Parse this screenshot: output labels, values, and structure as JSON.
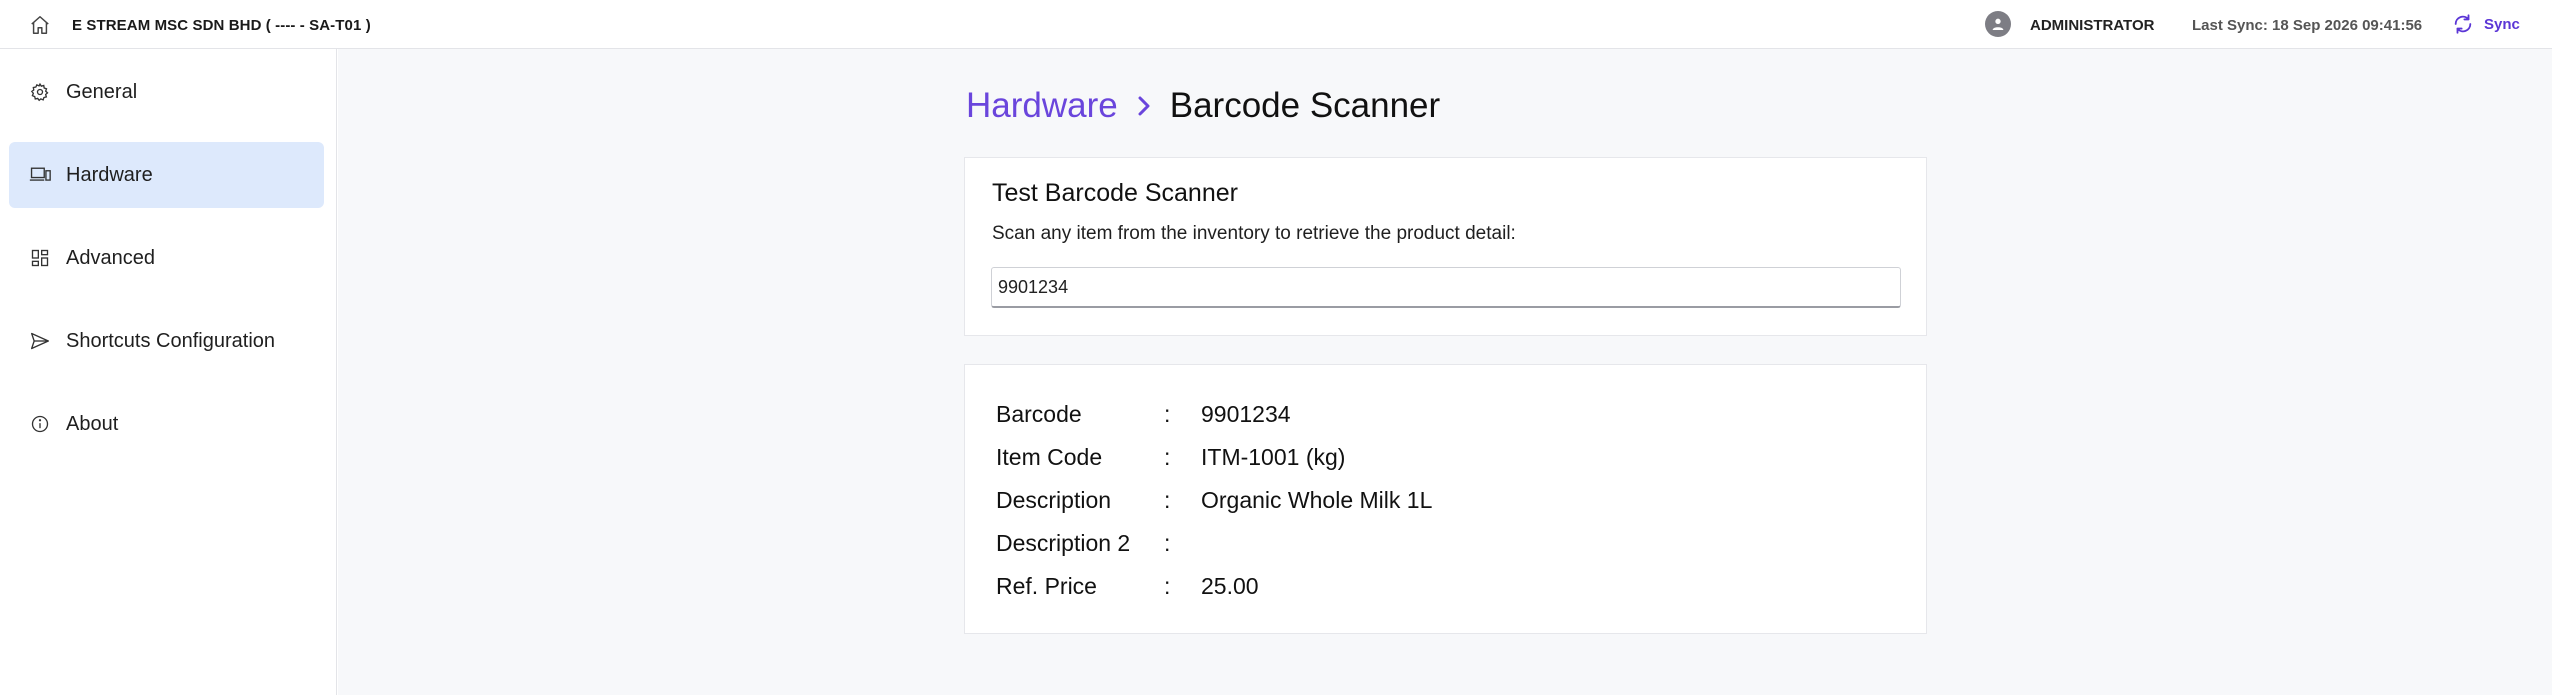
{
  "topbar": {
    "company": "E STREAM MSC SDN BHD ( ---- - SA-T01 )",
    "user": "ADMINISTRATOR",
    "last_sync": "Last Sync: 18 Sep 2026 09:41:56",
    "sync_label": "Sync",
    "icons": {
      "home": "home-icon",
      "avatar": "user-icon",
      "sync": "sync-icon"
    }
  },
  "sidebar": {
    "items": [
      {
        "label": "General",
        "icon": "gear-icon",
        "active": false
      },
      {
        "label": "Hardware",
        "icon": "devices-icon",
        "active": true
      },
      {
        "label": "Advanced",
        "icon": "grid-icon",
        "active": false
      },
      {
        "label": "Shortcuts Configuration",
        "icon": "send-icon",
        "active": false
      },
      {
        "label": "About",
        "icon": "info-icon",
        "active": false
      }
    ]
  },
  "breadcrumb": {
    "parent": "Hardware",
    "current": "Barcode Scanner"
  },
  "test_card": {
    "title": "Test Barcode Scanner",
    "subtitle": "Scan any item from the inventory to retrieve the product detail:",
    "input_value": "9901234"
  },
  "detail_card": {
    "rows": [
      {
        "label": "Barcode",
        "sep": ":",
        "value": "9901234"
      },
      {
        "label": "Item Code",
        "sep": ":",
        "value": "ITM-1001 (kg)"
      },
      {
        "label": "Description",
        "sep": ":",
        "value": "Organic Whole Milk 1L"
      },
      {
        "label": "Description 2",
        "sep": ":",
        "value": ""
      },
      {
        "label": "Ref. Price",
        "sep": ":",
        "value": "25.00"
      }
    ]
  },
  "colors": {
    "accent": "#5b36d6",
    "active_nav_bg": "#dde9fc",
    "main_bg": "#f7f8fa"
  }
}
